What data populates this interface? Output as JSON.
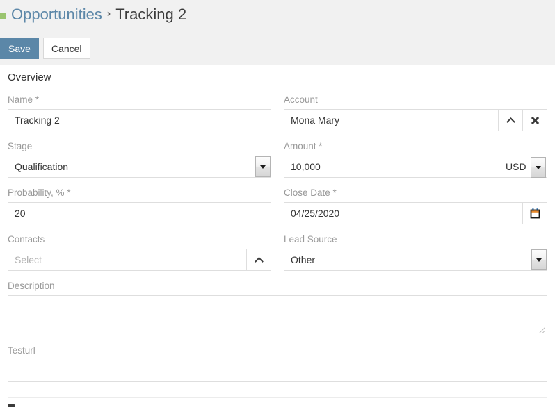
{
  "breadcrumb": {
    "square_color": "#9ac46f",
    "parent": "Opportunities",
    "separator": "›",
    "current": "Tracking 2"
  },
  "toolbar": {
    "save_label": "Save",
    "cancel_label": "Cancel",
    "primary_color": "#5b87a8"
  },
  "panel": {
    "title": "Overview"
  },
  "fields": {
    "name": {
      "label": "Name *",
      "value": "Tracking 2"
    },
    "account": {
      "label": "Account",
      "value": "Mona Mary",
      "up_icon": "chevron-up-icon",
      "clear_icon": "close-x-icon"
    },
    "stage": {
      "label": "Stage",
      "value": "Qualification",
      "arrow_icon": "chevron-down-icon"
    },
    "amount": {
      "label": "Amount *",
      "value": "10,000",
      "currency": "USD",
      "arrow_icon": "chevron-down-icon"
    },
    "probability": {
      "label": "Probability, % *",
      "value": "20"
    },
    "close_date": {
      "label": "Close Date *",
      "value": "04/25/2020",
      "calendar_icon": "calendar-icon"
    },
    "contacts": {
      "label": "Contacts",
      "placeholder": "Select",
      "value": "",
      "up_icon": "chevron-up-icon"
    },
    "lead_source": {
      "label": "Lead Source",
      "value": "Other",
      "arrow_icon": "chevron-down-icon"
    },
    "description": {
      "label": "Description",
      "value": "",
      "placeholder": ""
    },
    "testurl": {
      "label": "Testurl",
      "value": "",
      "placeholder": ""
    }
  }
}
